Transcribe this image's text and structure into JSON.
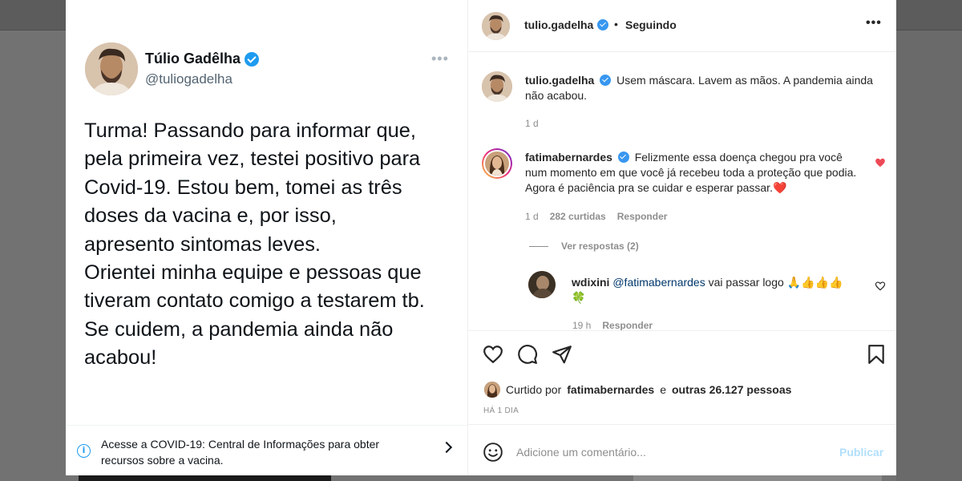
{
  "tweet": {
    "name": "Túlio Gadêlha",
    "handle": "@tuliogadelha",
    "more": "•••",
    "text": "Turma! Passando para informar que,\npela primeira vez, testei positivo para\nCovid-19. Estou bem, tomei as três\ndoses da vacina e, por isso,\napresento sintomas leves.\nOrientei minha equipe e pessoas que\ntiveram contato comigo a testarem tb.\nSe cuidem, a pandemia ainda não\nacabou!",
    "covid_banner": "Acesse a COVID-19: Central de Informações para obter recursos sobre a vacina.",
    "info_icon": "i"
  },
  "post": {
    "username": "tulio.gadelha",
    "dot": "•",
    "follow_status": "Seguindo",
    "more": "•••",
    "caption_user": "tulio.gadelha",
    "caption": "Usem máscara. Lavem as mãos. A pandemia ainda não acabou.",
    "caption_time": "1 d"
  },
  "comments": [
    {
      "user": "fatimabernardes",
      "text": "Felizmente essa doença chegou pra você num momento em que você já recebeu toda a proteção que podia. Agora é paciência pra se cuidar e esperar passar.",
      "emoji": "❤️",
      "time": "1 d",
      "likes": "282 curtidas",
      "reply": "Responder",
      "liked": true
    }
  ],
  "view_replies": "Ver respostas (2)",
  "reply": {
    "user": "wdixini",
    "mention": "@fatimabernardes",
    "text": "vai passar logo",
    "emojis": "🙏👍👍👍",
    "emoji2": "🍀",
    "time": "19 h",
    "reply": "Responder"
  },
  "likes_line": {
    "prefix": "Curtido por",
    "user": "fatimabernardes",
    "middle": "e",
    "rest": "outras 26.127 pessoas"
  },
  "time_ago": "HÁ 1 DIA",
  "add_comment": {
    "placeholder": "Adicione um comentário...",
    "publish": "Publicar"
  },
  "colors": {
    "verified": "#3897f0",
    "twitter_blue": "#1d9bf0",
    "like_red": "#ed4956",
    "publish_disabled": "#b2dffc"
  }
}
